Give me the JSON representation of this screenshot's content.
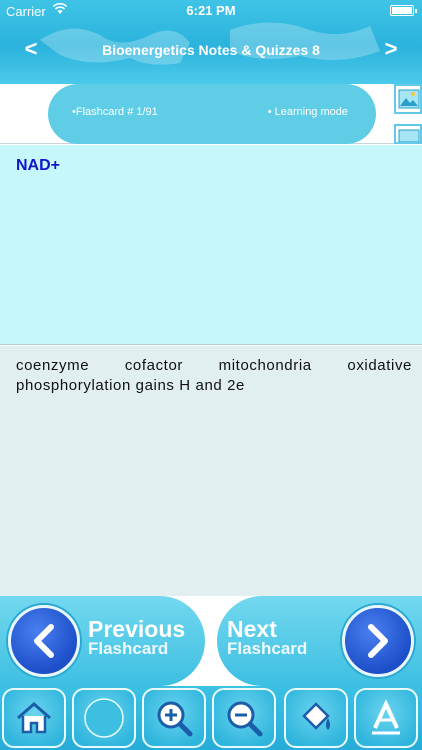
{
  "status_bar": {
    "carrier": "Carrier",
    "time": "6:21 PM"
  },
  "header": {
    "title": "Bioenergetics Notes & Quizzes 8",
    "prev": "<",
    "next": ">"
  },
  "info": {
    "flashcard": "•Flashcard #  1/91",
    "mode": "• Learning mode"
  },
  "card": {
    "front": "NAD+",
    "back": "coenzyme cofactor mitochondria oxidative phosphorylation gains H and 2e"
  },
  "nav_buttons": {
    "previous": {
      "line1": "Previous",
      "line2": "Flashcard"
    },
    "next": {
      "line1": "Next",
      "line2": "Flashcard"
    }
  },
  "toolbar": {
    "items": [
      "home-icon",
      "blank-icon",
      "zoom-in-icon",
      "zoom-out-icon",
      "paint-bucket-icon",
      "text-format-icon"
    ]
  },
  "colors": {
    "accent": "#3fc4e6",
    "front_bg": "#c6f7fb",
    "back_bg": "#e2eff1",
    "front_text": "#1414c8"
  }
}
